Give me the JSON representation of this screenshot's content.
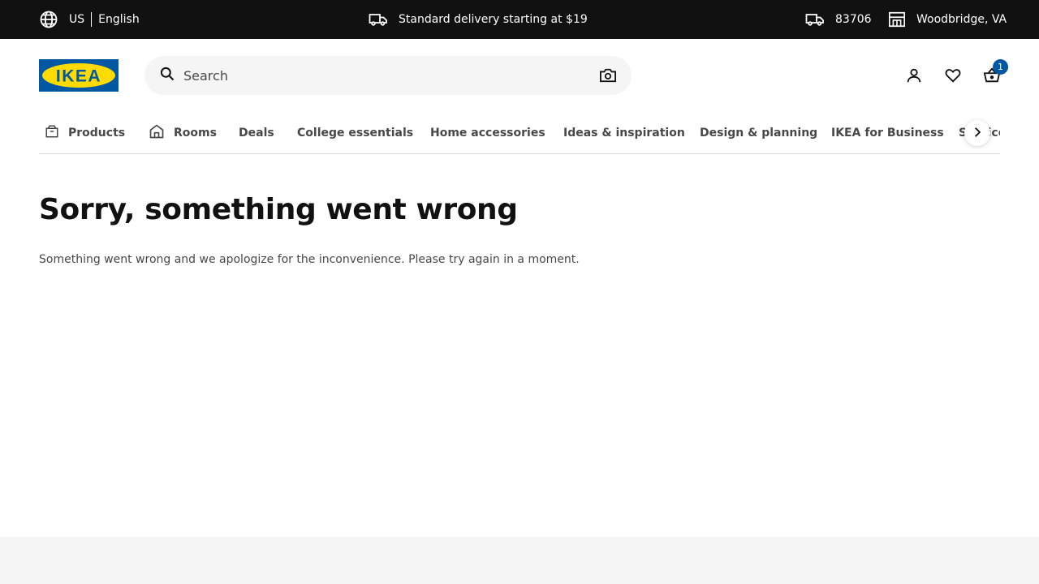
{
  "topbar": {
    "country": "US",
    "language": "English",
    "delivery_text": "Standard delivery starting at $19",
    "zip": "83706",
    "store": "Woodbridge, VA"
  },
  "header": {
    "logo_text": "IKEA",
    "search_placeholder": "Search",
    "cart_count": "1"
  },
  "nav": {
    "items": [
      {
        "label": "Products"
      },
      {
        "label": "Rooms"
      },
      {
        "label": "Deals"
      },
      {
        "label": "College essentials"
      },
      {
        "label": "Home accessories"
      },
      {
        "label": "Ideas & inspiration"
      },
      {
        "label": "Design & planning"
      },
      {
        "label": "IKEA for Business"
      },
      {
        "label": "Services"
      }
    ]
  },
  "main": {
    "title": "Sorry, something went wrong",
    "message": "Something went wrong and we apologize for the inconvenience. Please try again in a moment."
  },
  "colors": {
    "topbar_bg": "#111111",
    "brand_blue": "#0058a3",
    "brand_yellow": "#ffdb00"
  },
  "icons": [
    "globe-icon",
    "truck-icon",
    "store-icon",
    "search-icon",
    "camera-icon",
    "user-icon",
    "heart-icon",
    "basket-icon",
    "box-icon",
    "home-icon",
    "chevron-right-icon"
  ]
}
